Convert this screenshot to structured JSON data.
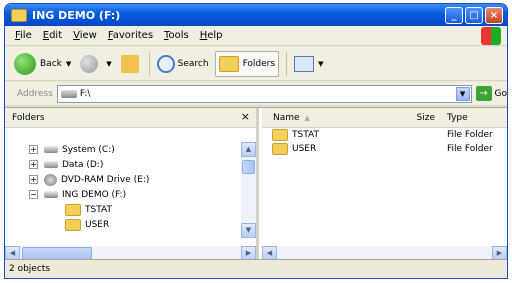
{
  "window": {
    "title": "ING DEMO (F:)"
  },
  "menu": [
    "File",
    "Edit",
    "View",
    "Favorites",
    "Tools",
    "Help"
  ],
  "toolbar": {
    "back": "Back",
    "search": "Search",
    "folders": "Folders"
  },
  "address": {
    "label": "Address",
    "value": "F:\\",
    "go": "Go"
  },
  "folders_pane": {
    "title": "Folders",
    "tree": [
      {
        "label": "System (C:)",
        "expander": "+",
        "icon": "drive-icon"
      },
      {
        "label": "Data (D:)",
        "expander": "+",
        "icon": "drive-icon"
      },
      {
        "label": "DVD-RAM Drive (E:)",
        "expander": "+",
        "icon": "dvd-drive-icon"
      },
      {
        "label": "ING DEMO (F:)",
        "expander": "−",
        "icon": "drive-icon"
      },
      {
        "label": "TSTAT",
        "icon": "folder-icon"
      },
      {
        "label": "USER",
        "icon": "folder-icon"
      }
    ]
  },
  "columns": {
    "name": "Name",
    "size": "Size",
    "type": "Type"
  },
  "files": [
    {
      "name": "TSTAT",
      "size": "",
      "type": "File Folder"
    },
    {
      "name": "USER",
      "size": "",
      "type": "File Folder"
    }
  ],
  "status": "2 objects",
  "colors": {
    "titlebar": "#0a5ee0",
    "chrome": "#ece9d8",
    "folder": "#f3cf5a"
  }
}
